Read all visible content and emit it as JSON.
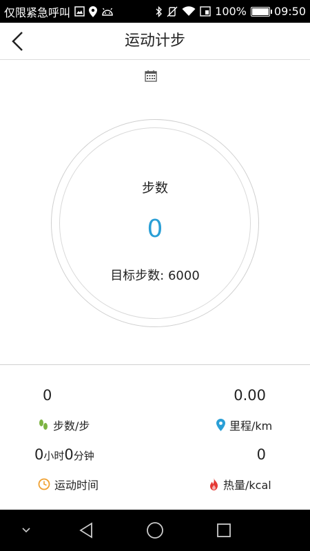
{
  "status_bar": {
    "carrier_text": "仅限紧急呼叫",
    "battery_percent": "100%",
    "time": "09:50",
    "battery_level": 1.0
  },
  "header": {
    "title": "运动计步"
  },
  "ring": {
    "label": "步数",
    "value": "0",
    "goal_text": "目标步数: 6000"
  },
  "stats": {
    "steps_value": "0",
    "steps_label": "步数/步",
    "distance_value": "0.00",
    "distance_label": "里程/km",
    "time_hours": "0",
    "time_hours_unit": "小时",
    "time_minutes": "0",
    "time_minutes_unit": "分钟",
    "time_label": "运动时间",
    "calories_value": "0",
    "calories_label": "热量/kcal"
  },
  "colors": {
    "accent": "#2a9fd6",
    "footprint_icon": "#7cb342",
    "location_icon": "#2a9fd6",
    "clock_icon": "#f0a030",
    "flame_icon": "#e53935"
  }
}
